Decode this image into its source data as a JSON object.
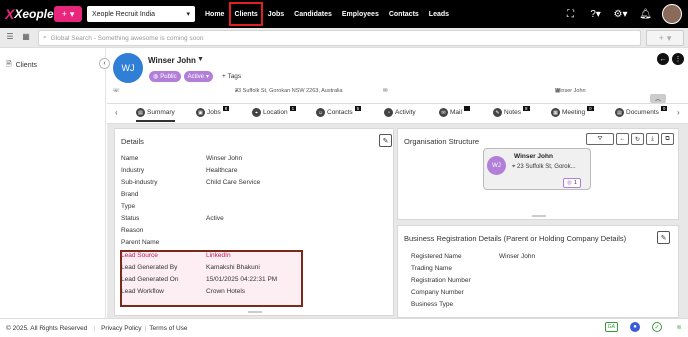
{
  "topbar": {
    "logo_text": "Xeople",
    "logo_sub": "recruit",
    "company": "Xeople Recruit India",
    "nav": [
      "Home",
      "Clients",
      "Jobs",
      "Candidates",
      "Employees",
      "Contacts",
      "Leads"
    ],
    "active_nav": "Clients"
  },
  "search": {
    "placeholder": "Global Search - Something awesome is coming soon"
  },
  "sidebar": {
    "items": [
      {
        "label": "Clients",
        "icon": "document-icon"
      }
    ]
  },
  "client": {
    "initials": "WJ",
    "name": "Winser John",
    "badge_public": "Public",
    "badge_active": "Active",
    "tags_label": "Tags",
    "phone": "--",
    "address": "23 Suffolk St, Gorokan NSW 2263, Australia",
    "owner": "Winser John"
  },
  "tabs": [
    {
      "label": "Summary",
      "count": null
    },
    {
      "label": "Jobs",
      "count": "8"
    },
    {
      "label": "Location",
      "count": "1"
    },
    {
      "label": "Contacts",
      "count": "5"
    },
    {
      "label": "Activity",
      "count": null
    },
    {
      "label": "Mail",
      "count": ""
    },
    {
      "label": "Notes",
      "count": "8"
    },
    {
      "label": "Meeting",
      "count": "0"
    },
    {
      "label": "Documents",
      "count": "0"
    }
  ],
  "details": {
    "title": "Details",
    "fields": [
      {
        "label": "Name",
        "value": "Winser John"
      },
      {
        "label": "Industry",
        "value": "Healthcare"
      },
      {
        "label": "Sub-industry",
        "value": "Child Care Service"
      },
      {
        "label": "Brand",
        "value": ""
      },
      {
        "label": "Type",
        "value": ""
      },
      {
        "label": "Status",
        "value": "Active"
      },
      {
        "label": "Reason",
        "value": ""
      },
      {
        "label": "Parent Name",
        "value": ""
      },
      {
        "label": "Lead Source",
        "value": "LinkedIn"
      },
      {
        "label": "Lead Generated By",
        "value": "Kamakshi Bhakuni"
      },
      {
        "label": "Lead Generated On",
        "value": "15/01/2025 04:22:31 PM"
      },
      {
        "label": "Lead Workflow",
        "value": "Crown Hotels"
      }
    ]
  },
  "org": {
    "title": "Organisation Structure",
    "card_initials": "WJ",
    "card_name": "Winser John",
    "card_address": "23 Suffolk St, Gorok...",
    "card_count": "1"
  },
  "business": {
    "title": "Business Registration Details (Parent or Holding Company Details)",
    "fields": [
      {
        "label": "Registered Name",
        "value": "Winser John"
      },
      {
        "label": "Trading Name",
        "value": ""
      },
      {
        "label": "Registration Number",
        "value": ""
      },
      {
        "label": "Company Number",
        "value": ""
      },
      {
        "label": "Business Type",
        "value": ""
      }
    ]
  },
  "footer": {
    "copyright": "© 2025. All Rights Reserved",
    "privacy": "Privacy Policy",
    "terms": "Terms of Use",
    "ga": "GA"
  },
  "colors": {
    "accent": "#e8277c",
    "brand_blue": "#2f7fd6",
    "lead_highlight": "#fdeef3",
    "lead_border": "#7a2a1a"
  }
}
